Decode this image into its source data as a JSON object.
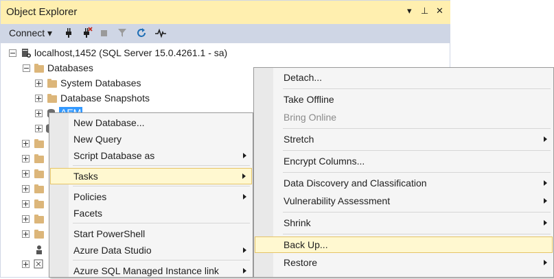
{
  "panel": {
    "title": "Object Explorer",
    "title_glyphs": [
      "▾",
      "⊥",
      "✕"
    ],
    "connect_label": "Connect ▾"
  },
  "tree": {
    "server": "localhost,1452 (SQL Server 15.0.4261.1 - sa)",
    "databases": "Databases",
    "system_databases": "System Databases",
    "database_snapshots": "Database Snapshots",
    "selected_db": "AEM"
  },
  "context_menu": {
    "items": [
      {
        "label": "New Database...",
        "submenu": false
      },
      {
        "label": "New Query",
        "submenu": false
      },
      {
        "label": "Script Database as",
        "submenu": true
      },
      {
        "label": "Tasks",
        "submenu": true,
        "highlighted": true
      },
      {
        "label": "Policies",
        "submenu": true
      },
      {
        "label": "Facets",
        "submenu": false
      },
      {
        "label": "Start PowerShell",
        "submenu": false
      },
      {
        "label": "Azure Data Studio",
        "submenu": true
      },
      {
        "label": "Azure SQL Managed Instance link",
        "submenu": true
      }
    ]
  },
  "tasks_menu": {
    "items": [
      {
        "label": "Detach...",
        "submenu": false
      },
      {
        "label": "Take Offline",
        "submenu": false
      },
      {
        "label": "Bring Online",
        "submenu": false,
        "disabled": true
      },
      {
        "label": "Stretch",
        "submenu": true
      },
      {
        "label": "Encrypt Columns...",
        "submenu": false
      },
      {
        "label": "Data Discovery and Classification",
        "submenu": true
      },
      {
        "label": "Vulnerability Assessment",
        "submenu": true
      },
      {
        "label": "Shrink",
        "submenu": true
      },
      {
        "label": "Back Up...",
        "submenu": false,
        "highlighted": true
      },
      {
        "label": "Restore",
        "submenu": true
      }
    ]
  },
  "colors": {
    "title_bar": "#ffefaf",
    "toolbar": "#cfd6e5",
    "selection": "#3399ff",
    "menu_highlight": "#fff8d0",
    "refresh_icon": "#1f6fb5"
  }
}
